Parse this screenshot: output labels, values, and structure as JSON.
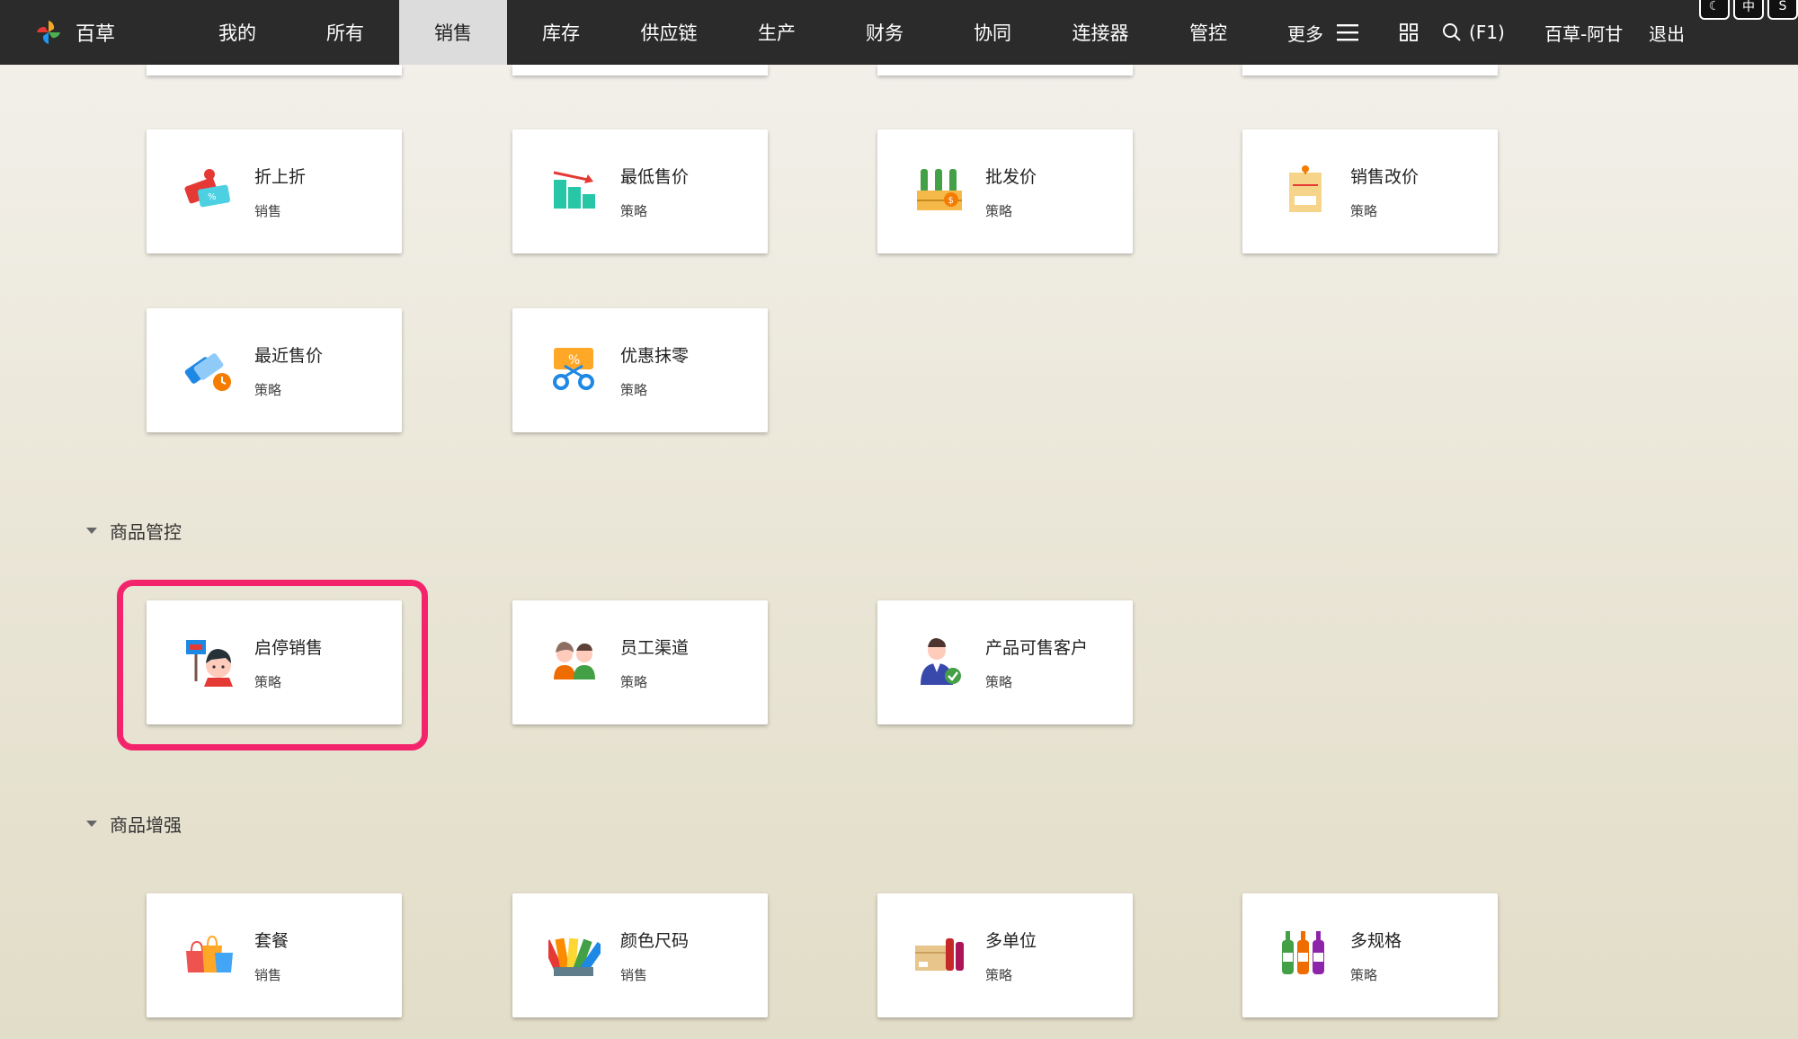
{
  "brand": {
    "name": "百草"
  },
  "nav": [
    "我的",
    "所有",
    "销售",
    "库存",
    "供应链",
    "生产",
    "财务",
    "协同",
    "连接器",
    "管控"
  ],
  "nav_active": "销售",
  "toolbar": {
    "more_label": "更多",
    "search_shortcut": "(F1)",
    "user": "百草-阿甘",
    "logout": "退出"
  },
  "corner": [
    "☾",
    "中",
    "S"
  ],
  "sections": {
    "goods_control": "商品管控",
    "goods_enhance": "商品增强"
  },
  "cards": {
    "zheshangzhe": {
      "title": "折上折",
      "sub": "销售"
    },
    "zuidishoujia": {
      "title": "最低售价",
      "sub": "策略"
    },
    "pifajia": {
      "title": "批发价",
      "sub": "策略"
    },
    "xiaoshougaijia": {
      "title": "销售改价",
      "sub": "策略"
    },
    "zuijinshoujia": {
      "title": "最近售价",
      "sub": "策略"
    },
    "youhuimoling": {
      "title": "优惠抹零",
      "sub": "策略"
    },
    "qitingxiaoshou": {
      "title": "启停销售",
      "sub": "策略"
    },
    "yuangongqudao": {
      "title": "员工渠道",
      "sub": "策略"
    },
    "chanpinkeshou": {
      "title": "产品可售客户",
      "sub": "策略"
    },
    "taocan": {
      "title": "套餐",
      "sub": "销售"
    },
    "yansechima": {
      "title": "颜色尺码",
      "sub": "销售"
    },
    "duodanwei": {
      "title": "多单位",
      "sub": "策略"
    },
    "duoguige": {
      "title": "多规格",
      "sub": "策略"
    }
  },
  "colors": {
    "topbar": "#2b2b2b",
    "active_tab": "#dcdcdc",
    "highlight": "#f3246c"
  }
}
